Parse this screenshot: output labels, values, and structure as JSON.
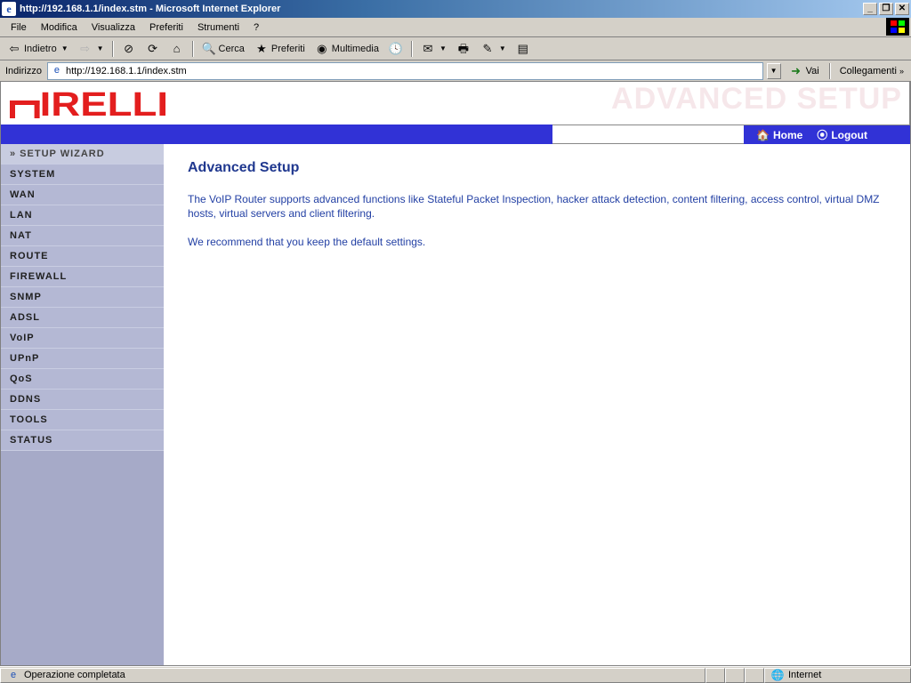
{
  "window": {
    "title": "http://192.168.1.1/index.stm - Microsoft Internet Explorer"
  },
  "menubar": [
    "File",
    "Modifica",
    "Visualizza",
    "Preferiti",
    "Strumenti",
    "?"
  ],
  "toolbar": {
    "back": "Indietro",
    "search": "Cerca",
    "favorites": "Preferiti",
    "media": "Multimedia"
  },
  "address": {
    "label": "Indirizzo",
    "url": "http://192.168.1.1/index.stm",
    "go": "Vai",
    "links": "Collegamenti"
  },
  "brand": {
    "logo_text": "IRELLI",
    "ghost": "ADVANCED SETUP"
  },
  "topnav": {
    "home": "Home",
    "logout": "Logout"
  },
  "sidebar": [
    {
      "label": "» SETUP WIZARD",
      "active": true
    },
    {
      "label": "SYSTEM"
    },
    {
      "label": "WAN"
    },
    {
      "label": "LAN"
    },
    {
      "label": "NAT"
    },
    {
      "label": "ROUTE"
    },
    {
      "label": "FIREWALL"
    },
    {
      "label": "SNMP"
    },
    {
      "label": "ADSL"
    },
    {
      "label": "VoIP"
    },
    {
      "label": "UPnP"
    },
    {
      "label": "QoS"
    },
    {
      "label": "DDNS"
    },
    {
      "label": "TOOLS"
    },
    {
      "label": "STATUS"
    }
  ],
  "main": {
    "heading": "Advanced Setup",
    "p1": "The VoIP Router supports advanced functions like Stateful Packet Inspection, hacker attack detection, content filtering, access control, virtual DMZ hosts, virtual servers and client filtering.",
    "p2": "We recommend that you keep the default settings."
  },
  "status": {
    "text": "Operazione completata",
    "zone": "Internet"
  }
}
